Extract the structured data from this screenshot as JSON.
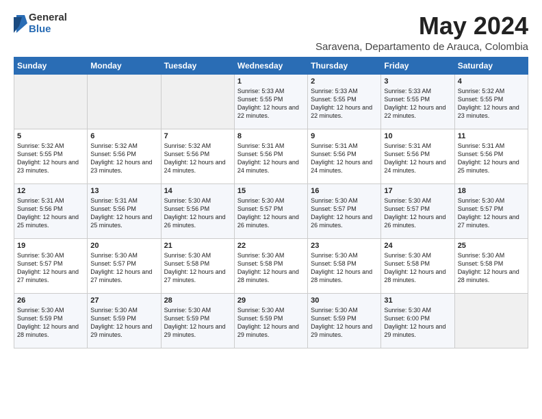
{
  "logo": {
    "general": "General",
    "blue": "Blue"
  },
  "title": "May 2024",
  "location": "Saravena, Departamento de Arauca, Colombia",
  "days_of_week": [
    "Sunday",
    "Monday",
    "Tuesday",
    "Wednesday",
    "Thursday",
    "Friday",
    "Saturday"
  ],
  "weeks": [
    [
      {
        "day": "",
        "content": ""
      },
      {
        "day": "",
        "content": ""
      },
      {
        "day": "",
        "content": ""
      },
      {
        "day": "1",
        "content": "Sunrise: 5:33 AM\nSunset: 5:55 PM\nDaylight: 12 hours\nand 22 minutes."
      },
      {
        "day": "2",
        "content": "Sunrise: 5:33 AM\nSunset: 5:55 PM\nDaylight: 12 hours\nand 22 minutes."
      },
      {
        "day": "3",
        "content": "Sunrise: 5:33 AM\nSunset: 5:55 PM\nDaylight: 12 hours\nand 22 minutes."
      },
      {
        "day": "4",
        "content": "Sunrise: 5:32 AM\nSunset: 5:55 PM\nDaylight: 12 hours\nand 23 minutes."
      }
    ],
    [
      {
        "day": "5",
        "content": "Sunrise: 5:32 AM\nSunset: 5:55 PM\nDaylight: 12 hours\nand 23 minutes."
      },
      {
        "day": "6",
        "content": "Sunrise: 5:32 AM\nSunset: 5:56 PM\nDaylight: 12 hours\nand 23 minutes."
      },
      {
        "day": "7",
        "content": "Sunrise: 5:32 AM\nSunset: 5:56 PM\nDaylight: 12 hours\nand 24 minutes."
      },
      {
        "day": "8",
        "content": "Sunrise: 5:31 AM\nSunset: 5:56 PM\nDaylight: 12 hours\nand 24 minutes."
      },
      {
        "day": "9",
        "content": "Sunrise: 5:31 AM\nSunset: 5:56 PM\nDaylight: 12 hours\nand 24 minutes."
      },
      {
        "day": "10",
        "content": "Sunrise: 5:31 AM\nSunset: 5:56 PM\nDaylight: 12 hours\nand 24 minutes."
      },
      {
        "day": "11",
        "content": "Sunrise: 5:31 AM\nSunset: 5:56 PM\nDaylight: 12 hours\nand 25 minutes."
      }
    ],
    [
      {
        "day": "12",
        "content": "Sunrise: 5:31 AM\nSunset: 5:56 PM\nDaylight: 12 hours\nand 25 minutes."
      },
      {
        "day": "13",
        "content": "Sunrise: 5:31 AM\nSunset: 5:56 PM\nDaylight: 12 hours\nand 25 minutes."
      },
      {
        "day": "14",
        "content": "Sunrise: 5:30 AM\nSunset: 5:56 PM\nDaylight: 12 hours\nand 26 minutes."
      },
      {
        "day": "15",
        "content": "Sunrise: 5:30 AM\nSunset: 5:57 PM\nDaylight: 12 hours\nand 26 minutes."
      },
      {
        "day": "16",
        "content": "Sunrise: 5:30 AM\nSunset: 5:57 PM\nDaylight: 12 hours\nand 26 minutes."
      },
      {
        "day": "17",
        "content": "Sunrise: 5:30 AM\nSunset: 5:57 PM\nDaylight: 12 hours\nand 26 minutes."
      },
      {
        "day": "18",
        "content": "Sunrise: 5:30 AM\nSunset: 5:57 PM\nDaylight: 12 hours\nand 27 minutes."
      }
    ],
    [
      {
        "day": "19",
        "content": "Sunrise: 5:30 AM\nSunset: 5:57 PM\nDaylight: 12 hours\nand 27 minutes."
      },
      {
        "day": "20",
        "content": "Sunrise: 5:30 AM\nSunset: 5:57 PM\nDaylight: 12 hours\nand 27 minutes."
      },
      {
        "day": "21",
        "content": "Sunrise: 5:30 AM\nSunset: 5:58 PM\nDaylight: 12 hours\nand 27 minutes."
      },
      {
        "day": "22",
        "content": "Sunrise: 5:30 AM\nSunset: 5:58 PM\nDaylight: 12 hours\nand 28 minutes."
      },
      {
        "day": "23",
        "content": "Sunrise: 5:30 AM\nSunset: 5:58 PM\nDaylight: 12 hours\nand 28 minutes."
      },
      {
        "day": "24",
        "content": "Sunrise: 5:30 AM\nSunset: 5:58 PM\nDaylight: 12 hours\nand 28 minutes."
      },
      {
        "day": "25",
        "content": "Sunrise: 5:30 AM\nSunset: 5:58 PM\nDaylight: 12 hours\nand 28 minutes."
      }
    ],
    [
      {
        "day": "26",
        "content": "Sunrise: 5:30 AM\nSunset: 5:59 PM\nDaylight: 12 hours\nand 28 minutes."
      },
      {
        "day": "27",
        "content": "Sunrise: 5:30 AM\nSunset: 5:59 PM\nDaylight: 12 hours\nand 29 minutes."
      },
      {
        "day": "28",
        "content": "Sunrise: 5:30 AM\nSunset: 5:59 PM\nDaylight: 12 hours\nand 29 minutes."
      },
      {
        "day": "29",
        "content": "Sunrise: 5:30 AM\nSunset: 5:59 PM\nDaylight: 12 hours\nand 29 minutes."
      },
      {
        "day": "30",
        "content": "Sunrise: 5:30 AM\nSunset: 5:59 PM\nDaylight: 12 hours\nand 29 minutes."
      },
      {
        "day": "31",
        "content": "Sunrise: 5:30 AM\nSunset: 6:00 PM\nDaylight: 12 hours\nand 29 minutes."
      },
      {
        "day": "",
        "content": ""
      }
    ]
  ]
}
